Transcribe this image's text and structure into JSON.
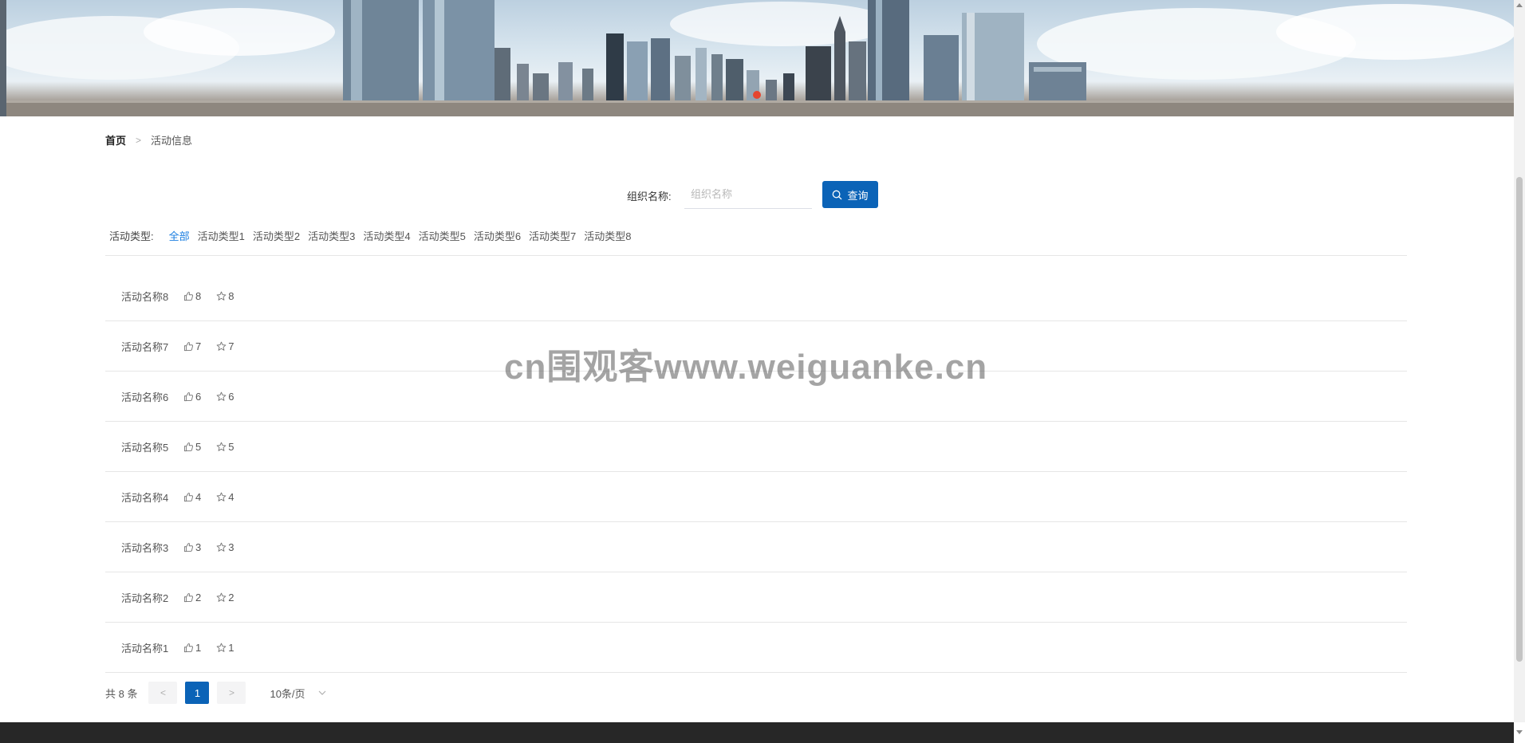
{
  "breadcrumb": {
    "home": "首页",
    "separator": ">",
    "current": "活动信息"
  },
  "search": {
    "label": "组织名称:",
    "placeholder": "组织名称",
    "value": "",
    "button_label": "查询"
  },
  "filter": {
    "label": "活动类型:",
    "types": [
      "全部",
      "活动类型1",
      "活动类型2",
      "活动类型3",
      "活动类型4",
      "活动类型5",
      "活动类型6",
      "活动类型7",
      "活动类型8"
    ],
    "active_index": 0
  },
  "activities": [
    {
      "name": "活动名称8",
      "likes": "8",
      "favorites": "8"
    },
    {
      "name": "活动名称7",
      "likes": "7",
      "favorites": "7"
    },
    {
      "name": "活动名称6",
      "likes": "6",
      "favorites": "6"
    },
    {
      "name": "活动名称5",
      "likes": "5",
      "favorites": "5"
    },
    {
      "name": "活动名称4",
      "likes": "4",
      "favorites": "4"
    },
    {
      "name": "活动名称3",
      "likes": "3",
      "favorites": "3"
    },
    {
      "name": "活动名称2",
      "likes": "2",
      "favorites": "2"
    },
    {
      "name": "活动名称1",
      "likes": "1",
      "favorites": "1"
    }
  ],
  "pagination": {
    "total": "共 8 条",
    "prev": "<",
    "next": ">",
    "current_page": "1",
    "page_size": "10条/页"
  },
  "watermark": "cn围观客www.weiguanke.cn",
  "colors": {
    "primary": "#0b63b7",
    "active_type": "#1a7ee0",
    "footer": "#272727",
    "banner_dot": "#e5452f"
  },
  "icons": {
    "like": "thumbs-up-icon",
    "favorite": "star-icon",
    "search": "search-icon",
    "dropdown": "chevron-down-icon"
  }
}
